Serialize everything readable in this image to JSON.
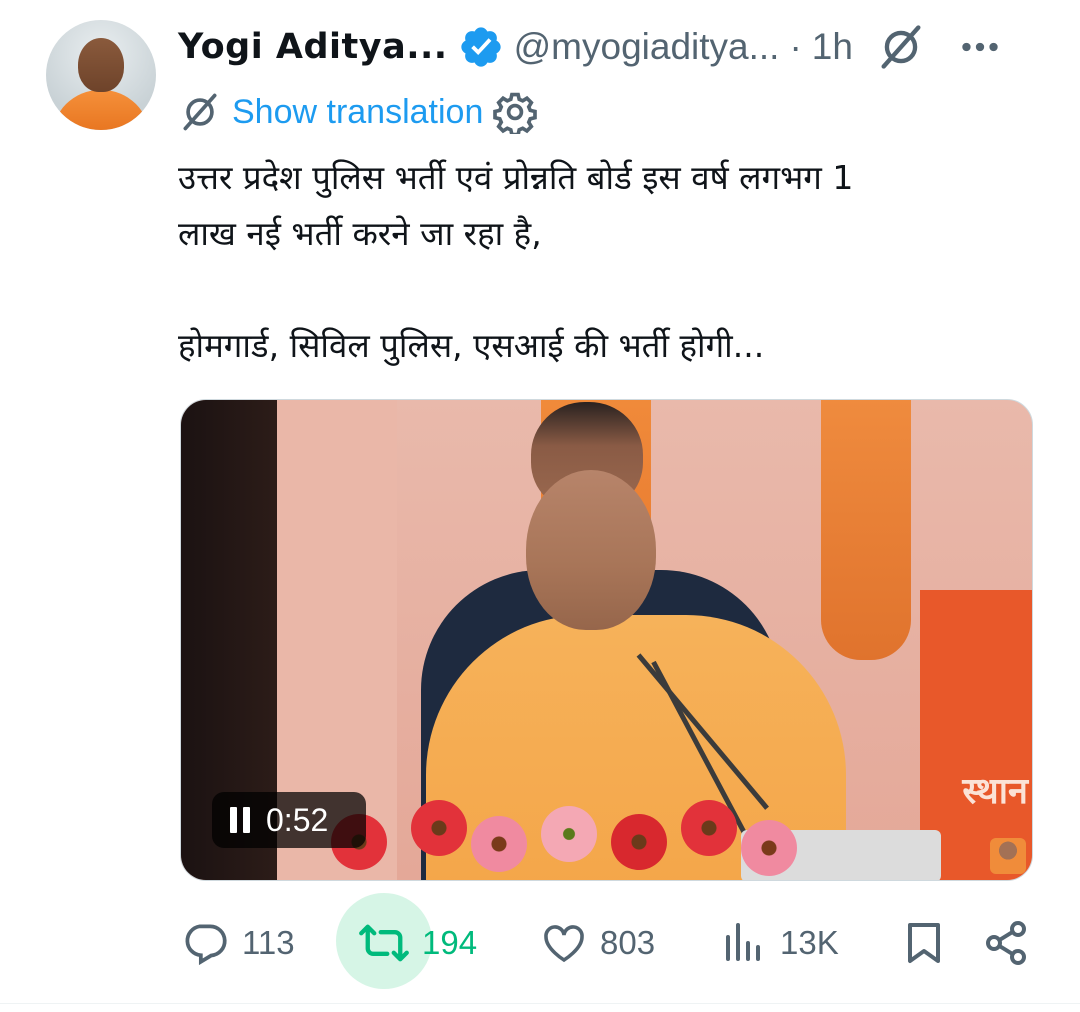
{
  "author": {
    "name": "Yogi Aditya...",
    "handle": "@myogiaditya...",
    "separator": "·",
    "time": "1h",
    "verified": true,
    "verified_color": "#1d9bf0"
  },
  "translation": {
    "label": "Show translation"
  },
  "tweet": {
    "line1": "उत्तर प्रदेश पुलिस भर्ती एवं प्रोन्नति बोर्ड इस वर्ष लगभग 1",
    "line2": "लाख नई भर्ती करने जा रहा है,",
    "line3": "होमगार्ड, सिविल पुलिस, एसआई की भर्ती होगी..."
  },
  "media": {
    "type": "video",
    "time": "0:52",
    "board_text": "स्थान"
  },
  "actions": {
    "replies": "113",
    "reposts": "194",
    "likes": "803",
    "views": "13K"
  },
  "colors": {
    "accent": "#1d9bf0",
    "repost_active": "#00ba7c",
    "secondary_text": "#536471"
  }
}
